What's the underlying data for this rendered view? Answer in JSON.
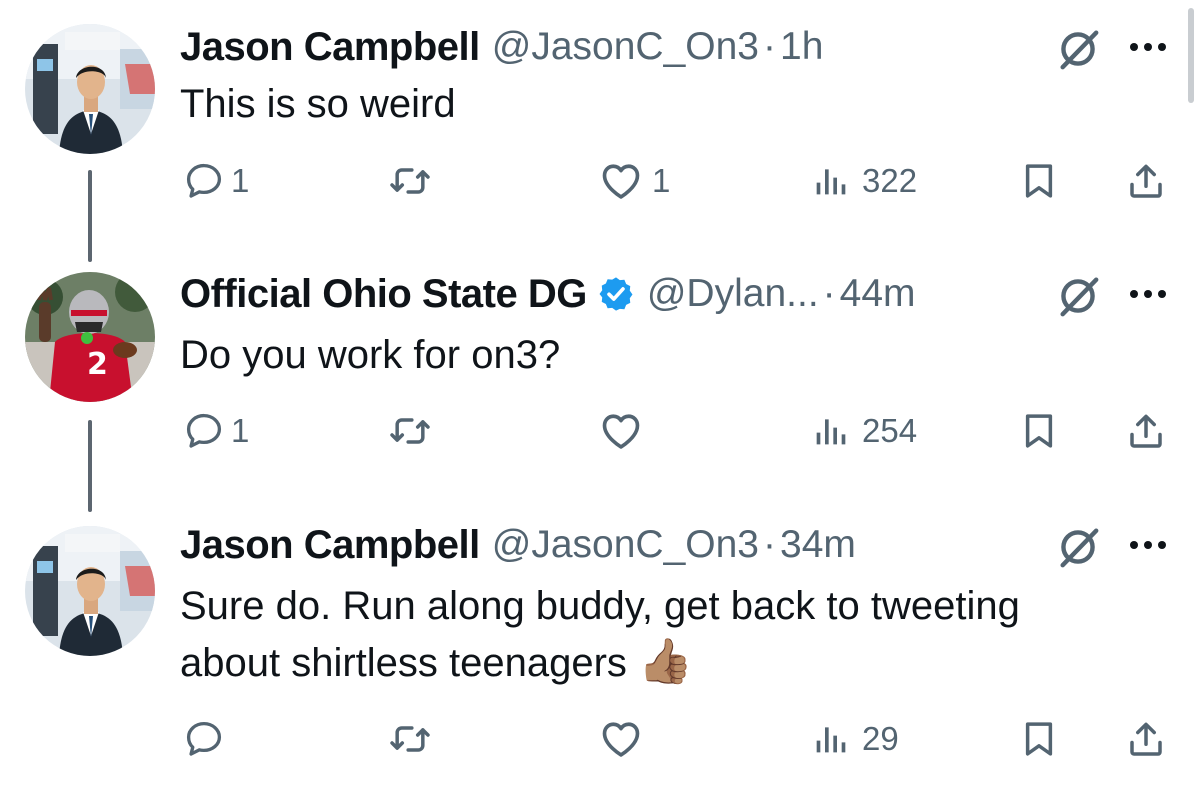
{
  "tweets": [
    {
      "name": "Jason Campbell",
      "handle": "@JasonC_On3",
      "separator": "·",
      "time": "1h",
      "text": [
        "This is so weird"
      ],
      "verified": false,
      "avatar_icon": "news-anchor-avatar",
      "stats": {
        "replies": "1",
        "retweets": "",
        "likes": "1",
        "views": "322"
      }
    },
    {
      "name": "Official Ohio State DG",
      "handle": "@Dylan...",
      "separator": "·",
      "time": "44m",
      "text": [
        "Do you work for on3?"
      ],
      "verified": true,
      "avatar_icon": "football-player-avatar",
      "stats": {
        "replies": "1",
        "retweets": "",
        "likes": "",
        "views": "254"
      }
    },
    {
      "name": "Jason Campbell",
      "handle": "@JasonC_On3",
      "separator": "·",
      "time": "34m",
      "text": [
        "Sure do. Run along buddy, get back to tweeting",
        "about shirtless teenagers"
      ],
      "emoji": "👍🏽",
      "verified": false,
      "avatar_icon": "news-anchor-avatar",
      "stats": {
        "replies": "",
        "retweets": "",
        "likes": "",
        "views": "29"
      }
    }
  ],
  "colors": {
    "text": "#0f1419",
    "secondary": "#536471",
    "verified": "#1d9bf0",
    "thread_line": "#5c6670"
  },
  "icons": [
    "reply-icon",
    "retweet-icon",
    "like-icon",
    "views-icon",
    "bookmark-icon",
    "share-icon",
    "grok-icon",
    "more-icon",
    "verified-badge-icon"
  ]
}
